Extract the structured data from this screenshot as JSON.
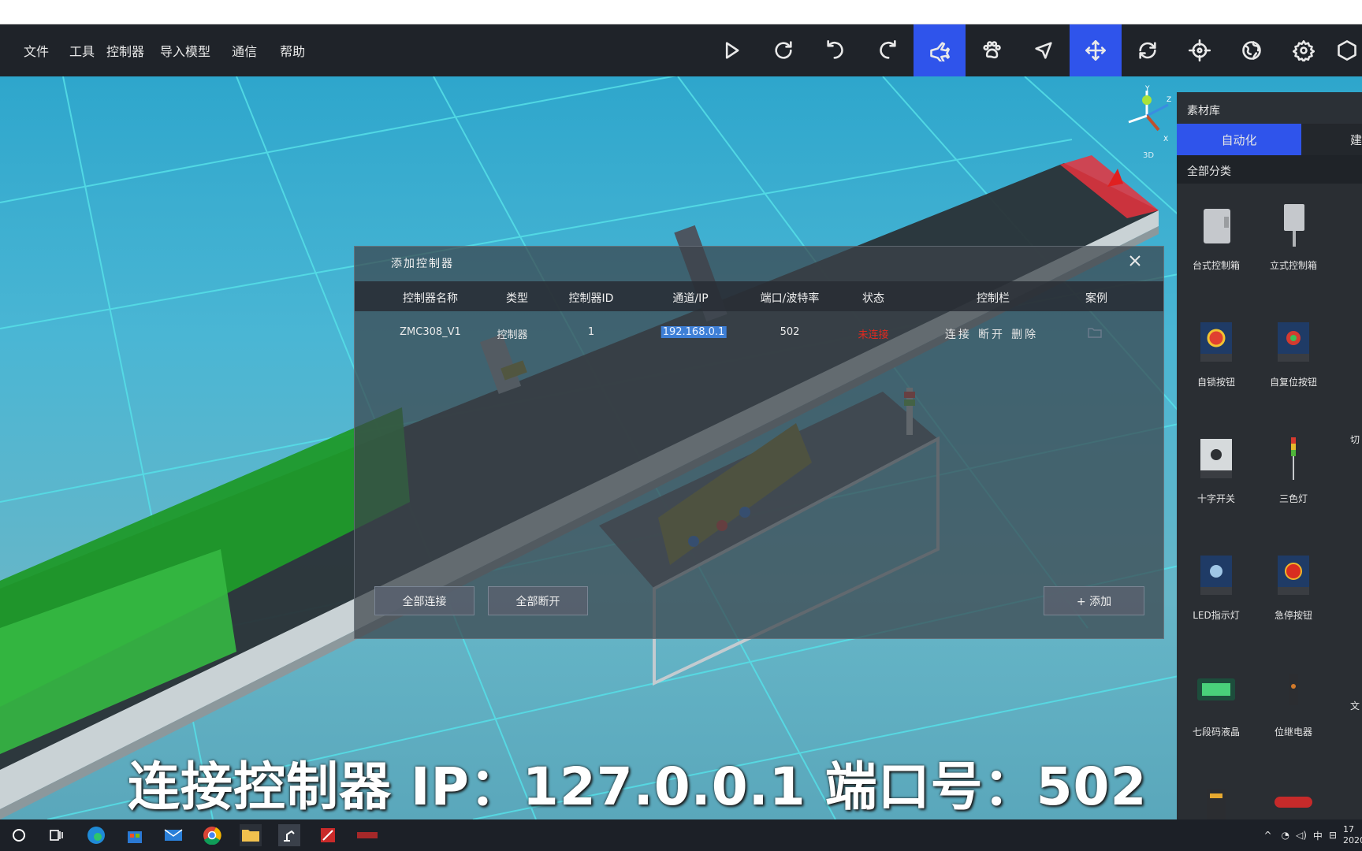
{
  "menubar": {
    "items": [
      "文件",
      "工具",
      "控制器",
      "导入模型",
      "通信",
      "帮助"
    ]
  },
  "toolbar": {
    "buttons": [
      {
        "name": "play-icon",
        "active": false
      },
      {
        "name": "refresh-icon",
        "active": false
      },
      {
        "name": "undo-icon",
        "active": false
      },
      {
        "name": "redo-icon",
        "active": false
      },
      {
        "name": "plane-icon",
        "active": true
      },
      {
        "name": "paw-icon",
        "active": false
      },
      {
        "name": "cursor-icon",
        "active": false
      },
      {
        "name": "move-icon",
        "active": true
      },
      {
        "name": "rotate-icon",
        "active": false
      },
      {
        "name": "crosshair-icon",
        "active": false
      },
      {
        "name": "globe-icon",
        "active": false
      },
      {
        "name": "gear-icon",
        "active": false
      }
    ],
    "active_color": "#2f54eb"
  },
  "gizmo": {
    "label": "3D"
  },
  "dialog": {
    "title": "添加控制器",
    "columns": [
      "控制器名称",
      "类型",
      "控制器ID",
      "通道/IP",
      "端口/波特率",
      "状态",
      "控制栏",
      "案例"
    ],
    "row": {
      "name": "ZMC308_V1",
      "type": "控制器",
      "id": "1",
      "ip": "192.168.0.1",
      "port": "502",
      "status": "未连接",
      "status_color": "#e0291f",
      "actions": [
        "连接",
        "断开",
        "删除"
      ]
    },
    "buttons": {
      "connect_all": "全部连接",
      "disconnect_all": "全部断开",
      "add": "+ 添加"
    }
  },
  "panel": {
    "title": "素材库",
    "tabs": [
      "自动化",
      "建"
    ],
    "category": "全部分类",
    "assets": [
      "台式控制箱",
      "立式控制箱",
      "自锁按钮",
      "自复位按钮",
      "十字开关",
      "三色灯",
      "LED指示灯",
      "急停按钮",
      "七段码液晶",
      "位继电器"
    ],
    "partial_labels": [
      "切",
      "文"
    ]
  },
  "caption": "连接控制器 IP：127.0.0.1   端口号：502",
  "taskbar": {
    "tray": {
      "ime": "中",
      "clock_partial": "2020",
      "time_partial": "17"
    }
  }
}
